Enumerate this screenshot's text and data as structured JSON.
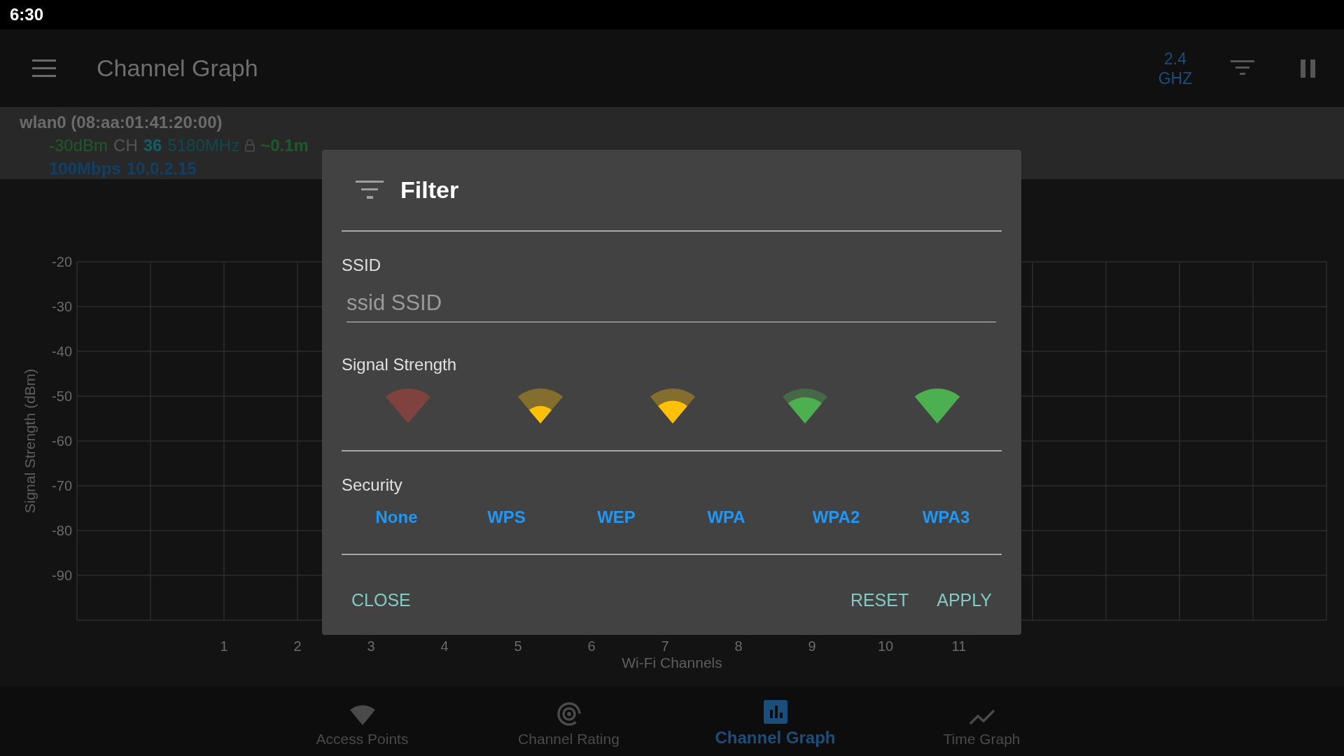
{
  "status_bar": {
    "time": "6:30"
  },
  "app_bar": {
    "title": "Channel Graph",
    "band": "2.4 GHZ"
  },
  "connection": {
    "interface": "wlan0 (08:aa:01:41:20:00)",
    "signal": "-30dBm",
    "channel_label": "CH",
    "channel": "36",
    "frequency": "5180MHz",
    "distance": "~0.1m",
    "speed": "100Mbps",
    "ip": "10.0.2.15"
  },
  "chart_data": {
    "type": "line",
    "grid": true,
    "xlabel": "Wi-Fi Channels",
    "ylabel": "Signal Strength (dBm)",
    "xlim": [
      -1,
      16
    ],
    "ylim": [
      -100,
      -20
    ],
    "xticks": [
      1,
      2,
      3,
      4,
      5,
      6,
      7,
      8,
      9,
      10,
      11
    ],
    "yticks": [
      -20,
      -30,
      -40,
      -50,
      -60,
      -70,
      -80,
      -90
    ]
  },
  "dialog": {
    "title": "Filter",
    "ssid_label": "SSID",
    "ssid_placeholder": "ssid SSID",
    "signal_label": "Signal Strength",
    "signal_levels": [
      {
        "kind": "none"
      },
      {
        "kind": "weak"
      },
      {
        "kind": "fair"
      },
      {
        "kind": "good"
      },
      {
        "kind": "excellent"
      }
    ],
    "security_label": "Security",
    "security_options": [
      {
        "label": "None"
      },
      {
        "label": "WPS"
      },
      {
        "label": "WEP"
      },
      {
        "label": "WPA"
      },
      {
        "label": "WPA2"
      },
      {
        "label": "WPA3"
      }
    ],
    "close": "CLOSE",
    "reset": "RESET",
    "apply": "APPLY"
  },
  "bottom_nav": [
    {
      "label": "Access Points",
      "kind": "wifi",
      "selected": false
    },
    {
      "label": "Channel Rating",
      "kind": "radar",
      "selected": false
    },
    {
      "label": "Channel Graph",
      "kind": "bars",
      "selected": true
    },
    {
      "label": "Time Graph",
      "kind": "trend",
      "selected": false
    }
  ]
}
